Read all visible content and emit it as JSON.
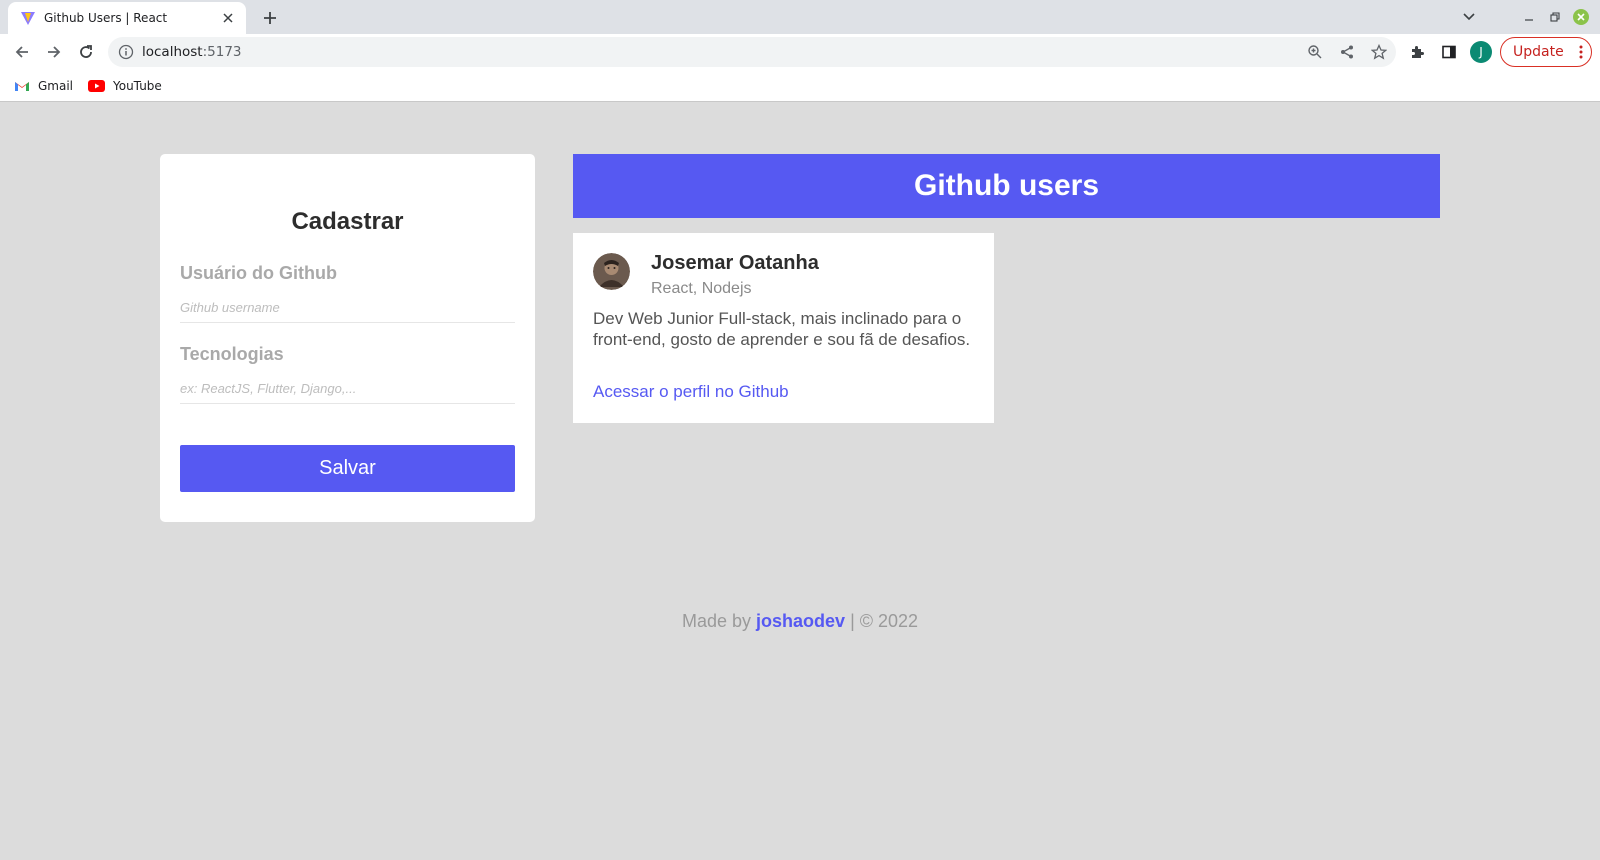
{
  "browser": {
    "tab": {
      "title": "Github Users | React",
      "favicon": "vite-icon"
    },
    "url": {
      "host": "localhost",
      "port": ":5173"
    },
    "update_label": "Update",
    "profile_initial": "J",
    "bookmarks": [
      {
        "label": "Gmail",
        "icon": "gmail-icon"
      },
      {
        "label": "YouTube",
        "icon": "youtube-icon"
      }
    ]
  },
  "form": {
    "title": "Cadastrar",
    "username_label": "Usuário do Github",
    "username_placeholder": "Github username",
    "tech_label": "Tecnologias",
    "tech_placeholder": "ex: ReactJS, Flutter, Django,...",
    "save_label": "Salvar"
  },
  "users": {
    "header": "Github users",
    "items": [
      {
        "name": "Josemar Oatanha",
        "techs": "React, Nodejs",
        "bio": "Dev Web Junior Full-stack, mais inclinado para o front-end, gosto de aprender e sou fã de desafios.",
        "link_label": "Acessar o perfil no Github"
      }
    ]
  },
  "footer": {
    "prefix": "Made by",
    "author": "joshaodev",
    "suffix": "| © 2022"
  },
  "colors": {
    "accent": "#5659f2",
    "background": "#dcdcdc"
  }
}
